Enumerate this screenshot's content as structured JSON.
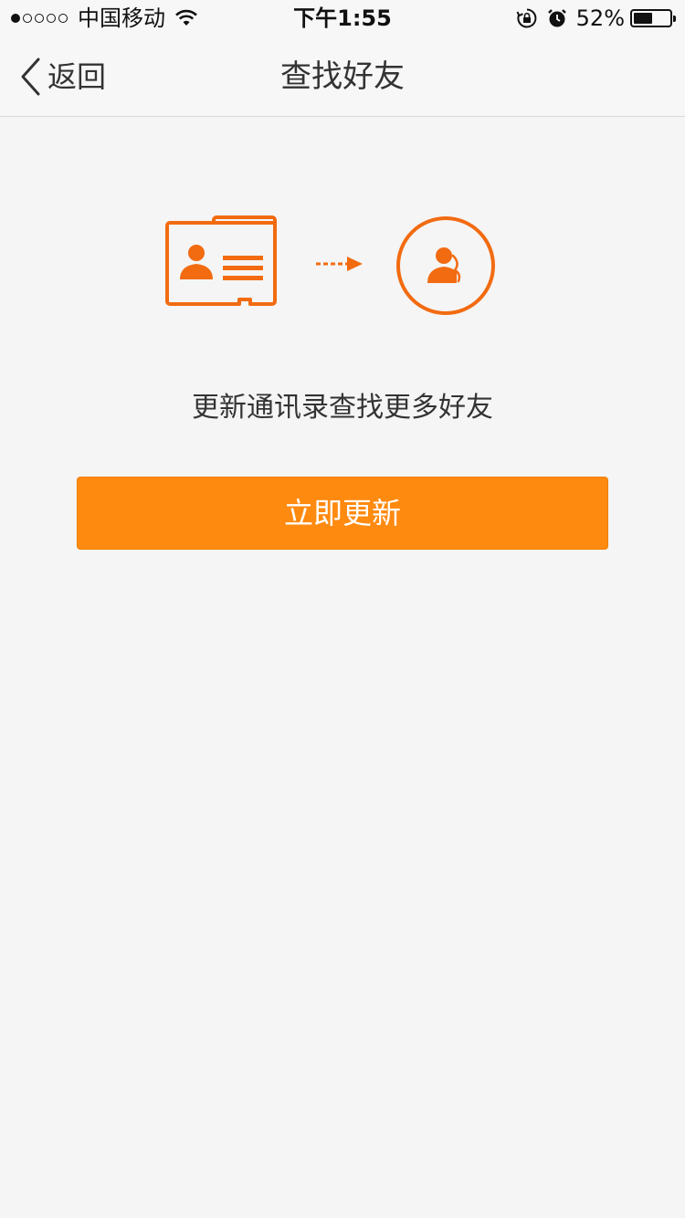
{
  "status_bar": {
    "signal_dots": [
      true,
      false,
      false,
      false,
      false
    ],
    "carrier": "中国移动",
    "time": "下午1:55",
    "battery_percent": "52%",
    "battery_level": 0.52,
    "icons": [
      "wifi-icon",
      "orientation-lock-icon",
      "alarm-icon",
      "battery-icon"
    ]
  },
  "nav": {
    "back_label": "返回",
    "title": "查找好友"
  },
  "main": {
    "message": "更新通讯录查找更多好友",
    "update_button_label": "立即更新"
  },
  "colors": {
    "accent": "#ff8a10",
    "icon_orange": "#f26b11",
    "background": "#f5f5f5"
  }
}
